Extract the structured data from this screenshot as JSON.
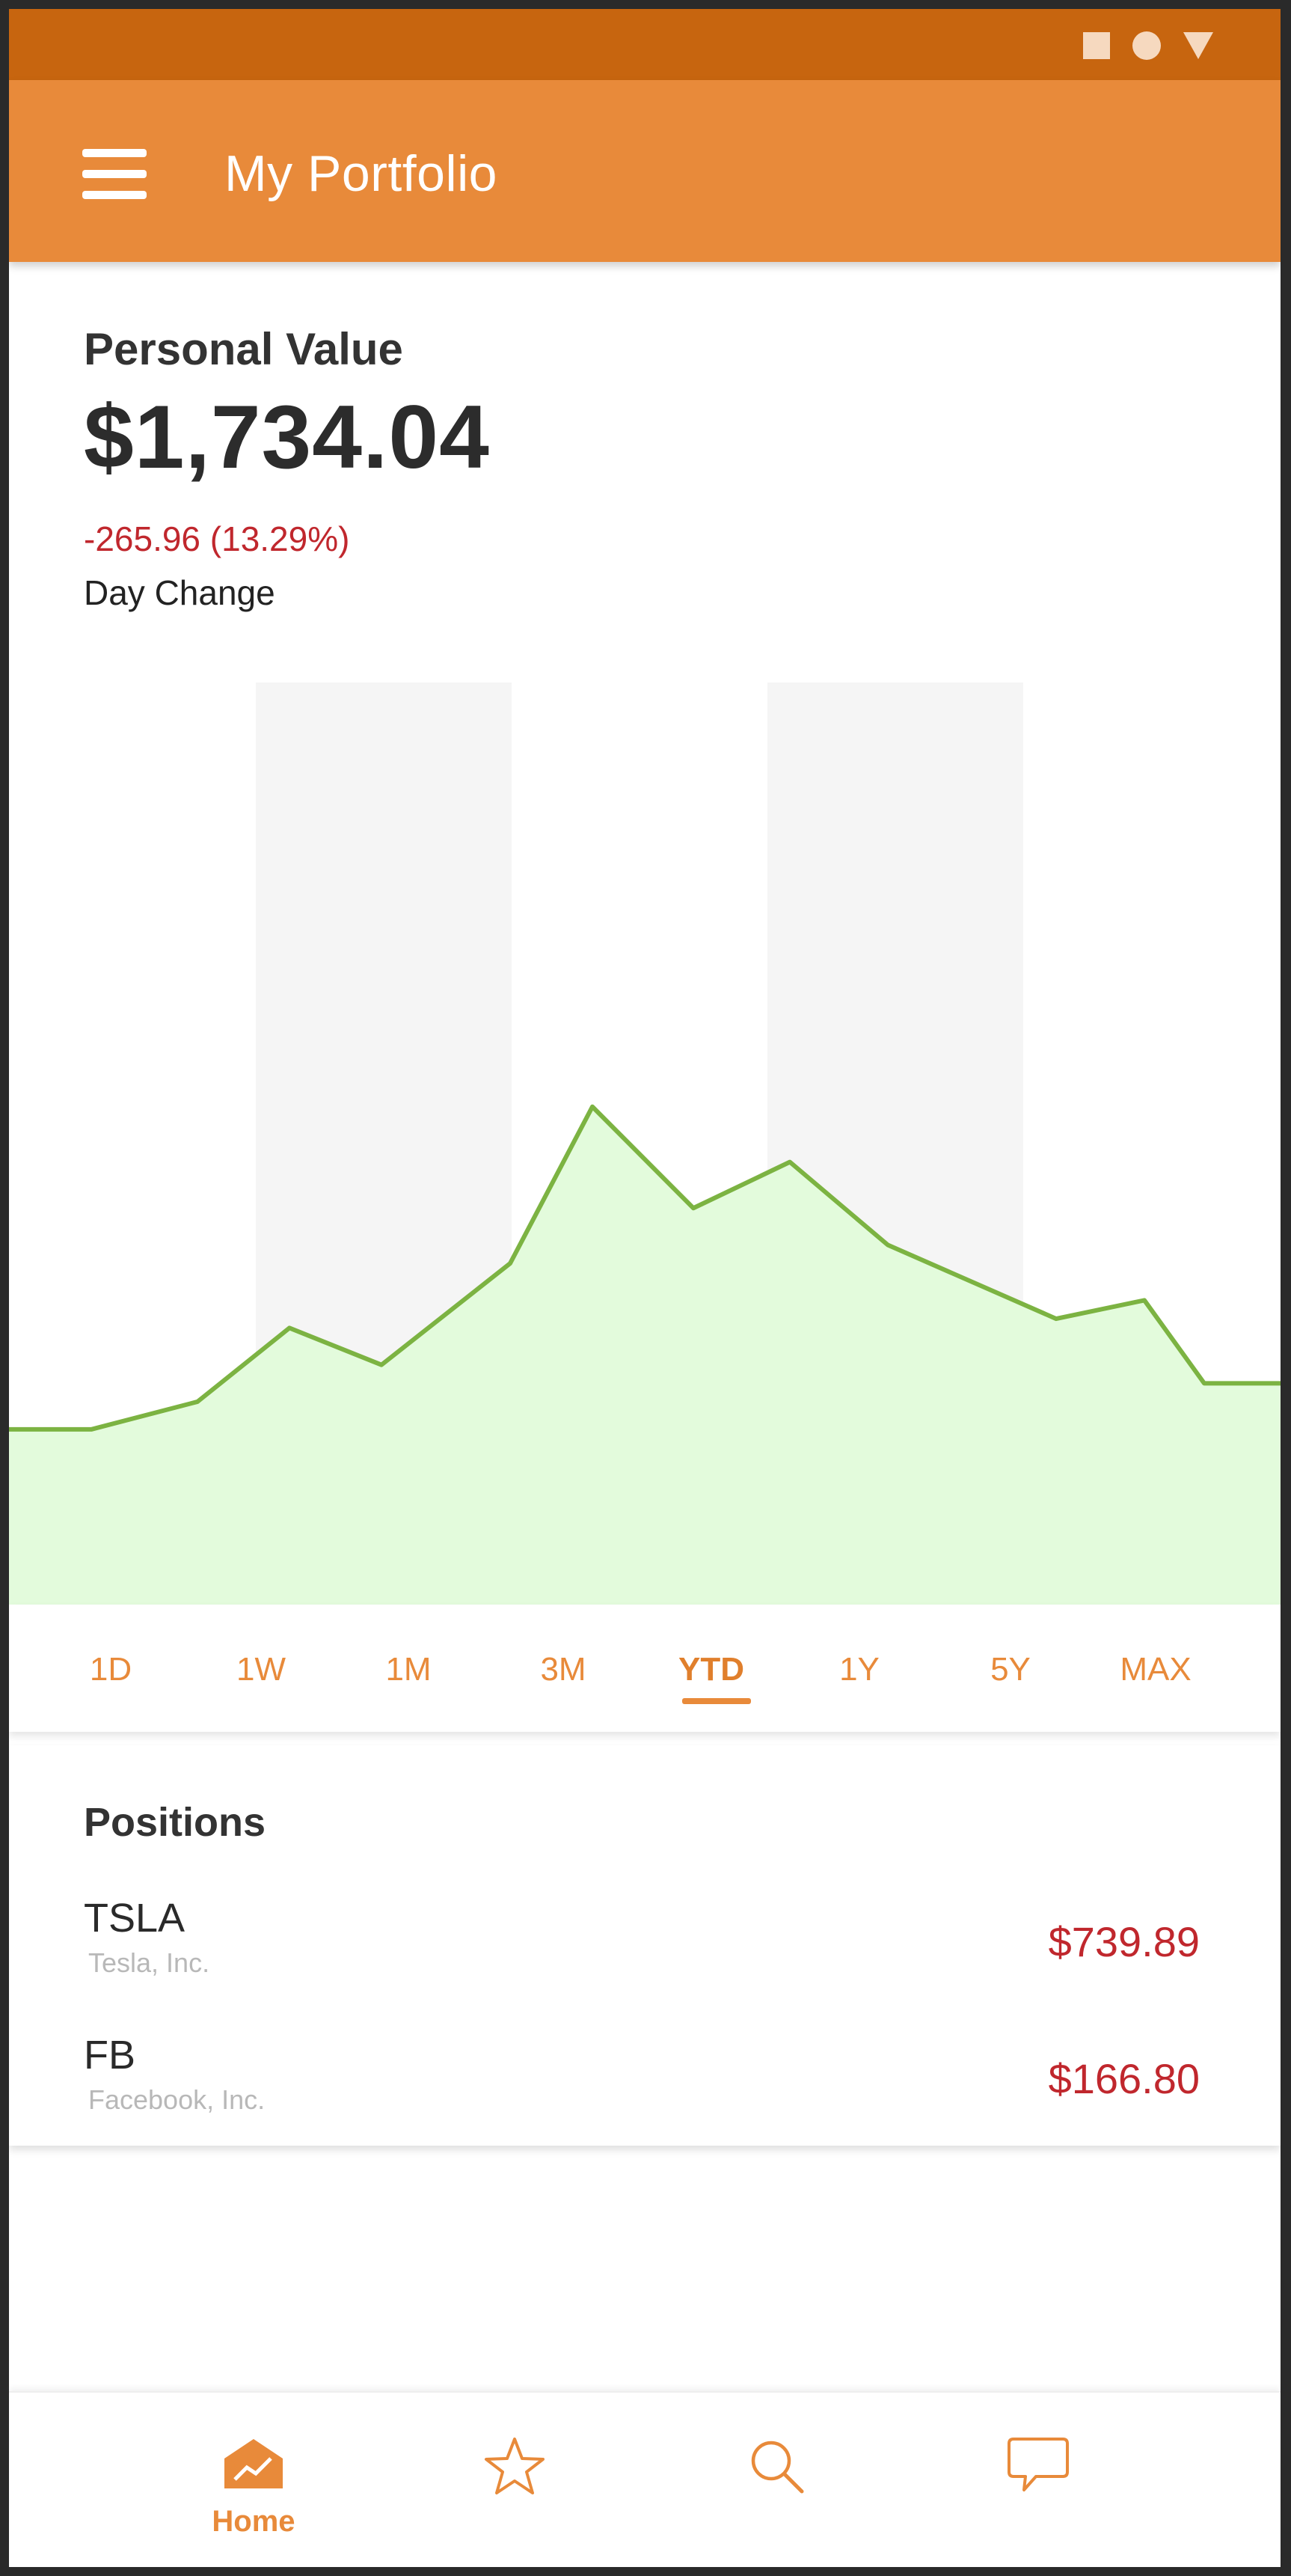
{
  "app": {
    "title": "My Portfolio"
  },
  "status_bar": {
    "icons": [
      "square-icon",
      "circle-icon",
      "triangle-icon"
    ]
  },
  "summary": {
    "label": "Personal Value",
    "value": "$1,734.04",
    "change": "-265.96 (13.29%)",
    "change_label": "Day Change"
  },
  "chart_data": {
    "type": "area",
    "x": [
      0,
      1,
      2,
      3,
      4,
      5,
      6,
      7,
      8,
      9,
      10,
      11,
      12,
      13
    ],
    "values": [
      19,
      19,
      22,
      30,
      26,
      37,
      54,
      43,
      48,
      39,
      31,
      33,
      24,
      24
    ],
    "ylim": [
      0,
      100
    ],
    "grid": false,
    "line_color": "#7cb342",
    "fill_color": "#e1fbd9",
    "band_color": "#f5f5f5"
  },
  "range_tabs": {
    "items": [
      "1D",
      "1W",
      "1M",
      "3M",
      "YTD",
      "1Y",
      "5Y",
      "MAX"
    ],
    "active": "YTD"
  },
  "positions": {
    "title": "Positions",
    "items": [
      {
        "symbol": "TSLA",
        "name": "Tesla, Inc.",
        "price": "$739.89"
      },
      {
        "symbol": "FB",
        "name": "Facebook, Inc.",
        "price": "$166.80"
      }
    ]
  },
  "bottom_nav": {
    "items": [
      {
        "icon": "home-chart-icon",
        "label": "Home"
      },
      {
        "icon": "star-icon",
        "label": ""
      },
      {
        "icon": "search-icon",
        "label": ""
      },
      {
        "icon": "chat-icon",
        "label": ""
      }
    ]
  },
  "colors": {
    "accent": "#e88a3a",
    "status_bar": "#c7650f",
    "negative": "#c0272d"
  }
}
